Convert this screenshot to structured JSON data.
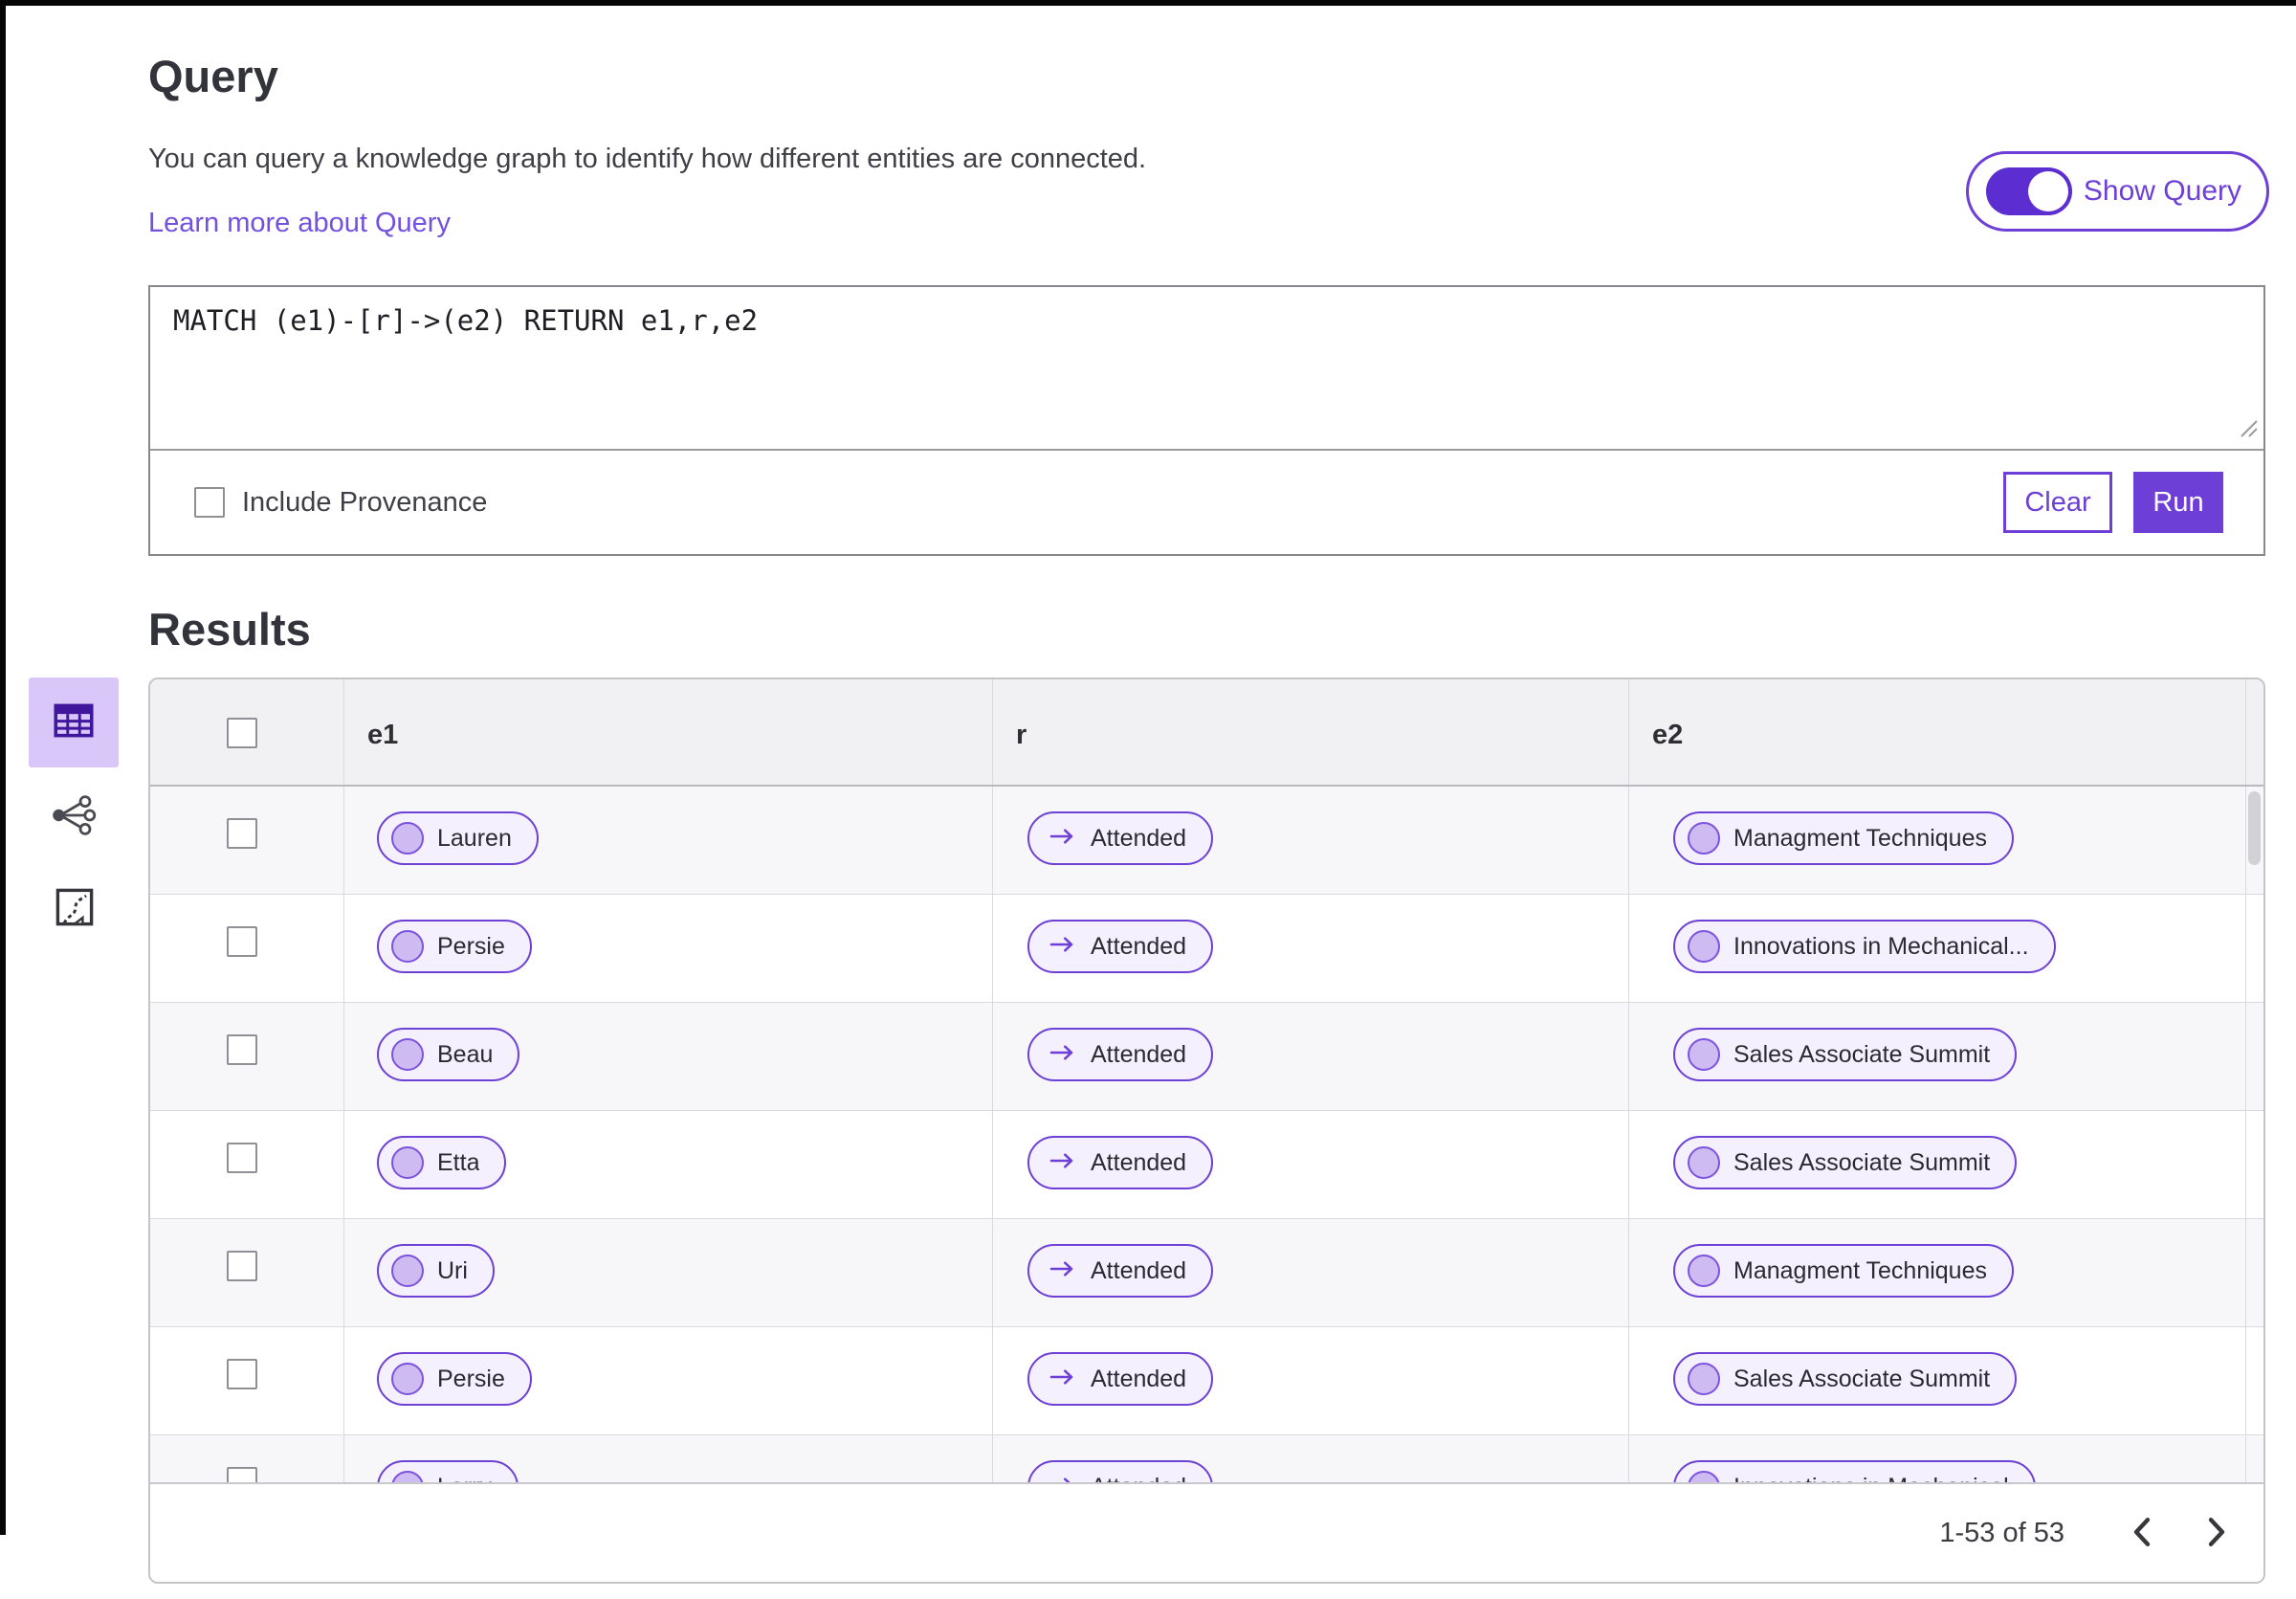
{
  "query": {
    "title": "Query",
    "description": "You can query a knowledge graph to identify how different entities are connected.",
    "learn_more_link": "Learn more about Query",
    "show_query_toggle": {
      "label": "Show Query",
      "state": "on"
    },
    "editor_text": "MATCH (e1)-[r]->(e2) RETURN e1,r,e2",
    "include_provenance": {
      "label": "Include Provenance",
      "checked": false
    },
    "buttons": {
      "clear": "Clear",
      "run": "Run"
    }
  },
  "results": {
    "title": "Results",
    "view_switcher": {
      "active": "table-view",
      "items": [
        {
          "name": "table-view",
          "icon": "table-icon",
          "active": true
        },
        {
          "name": "network-view",
          "icon": "network-graph-icon",
          "active": false
        },
        {
          "name": "map-view",
          "icon": "map-route-icon",
          "active": false
        }
      ]
    },
    "table": {
      "columns": [
        "e1",
        "r",
        "e2"
      ],
      "rows": [
        {
          "e1": "Lauren",
          "r": "Attended",
          "e2": "Managment Techniques"
        },
        {
          "e1": "Persie",
          "r": "Attended",
          "e2": "Innovations in Mechanical..."
        },
        {
          "e1": "Beau",
          "r": "Attended",
          "e2": "Sales Associate Summit"
        },
        {
          "e1": "Etta",
          "r": "Attended",
          "e2": "Sales Associate Summit"
        },
        {
          "e1": "Uri",
          "r": "Attended",
          "e2": "Managment Techniques"
        },
        {
          "e1": "Persie",
          "r": "Attended",
          "e2": "Sales Associate Summit"
        },
        {
          "e1": "Larry",
          "r": "Attended",
          "e2": "Innovations in Mechanical"
        }
      ]
    },
    "pagination": {
      "range_text": "1-53 of 53",
      "prev_icon": "chevron-left",
      "next_icon": "chevron-right"
    }
  },
  "colors": {
    "accent": "#6d3fd6",
    "toggle_fill": "#5c2dd0",
    "link": "#7350e0",
    "pill_bg": "#f4f0fd",
    "pill_circle_fill": "#cdbbf2",
    "active_view_bg": "#d8c7f8",
    "table_header_bg": "#f1f1f3",
    "row_stripe_bg": "#f7f7f9"
  }
}
